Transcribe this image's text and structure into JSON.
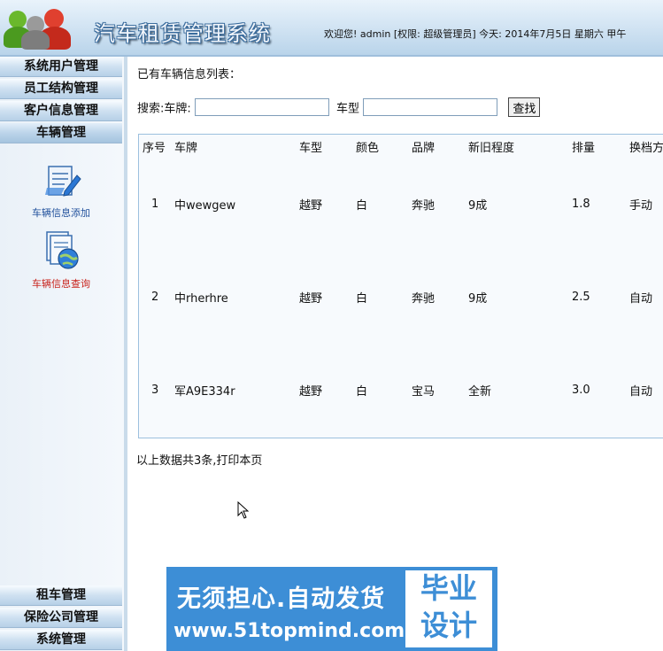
{
  "header": {
    "app_title": "汽车租赁管理系统",
    "welcome_text": "欢迎您! admin [权限: 超级管理员] 今天: 2014年7月5日 星期六 甲午"
  },
  "sidebar": {
    "top_menu": [
      {
        "label": "系统用户管理"
      },
      {
        "label": "员工结构管理"
      },
      {
        "label": "客户信息管理"
      },
      {
        "label": "车辆管理"
      }
    ],
    "sub_items": [
      {
        "label": "车辆信息添加",
        "icon": "document-edit-icon"
      },
      {
        "label": "车辆信息查询",
        "icon": "document-globe-icon"
      }
    ],
    "bottom_menu": [
      {
        "label": "租车管理"
      },
      {
        "label": "保险公司管理"
      },
      {
        "label": "系统管理"
      }
    ]
  },
  "main": {
    "list_title": "已有车辆信息列表：",
    "search": {
      "label_prefix": "搜索:车牌:",
      "plate_value": "",
      "type_label": "车型",
      "type_value": "",
      "button_label": "查找"
    },
    "table": {
      "headers": [
        "序号",
        "车牌",
        "车型",
        "颜色",
        "品牌",
        "新旧程度",
        "排量",
        "换档方"
      ],
      "rows": [
        [
          "1",
          "中wewgew",
          "越野",
          "白",
          "奔驰",
          "9成",
          "1.8",
          "手动"
        ],
        [
          "2",
          "中rherhre",
          "越野",
          "白",
          "奔驰",
          "9成",
          "2.5",
          "自动"
        ],
        [
          "3",
          "军A9E334r",
          "越野",
          "白",
          "宝马",
          "全新",
          "3.0",
          "自动"
        ]
      ]
    },
    "summary": "以上数据共3条,打印本页"
  },
  "banner": {
    "line1": "无须担心.自动发货",
    "line2": "www.51topmind.com",
    "right_top": "毕业",
    "right_bottom": "设计"
  },
  "colors": {
    "header_bg": "#cfe2f2",
    "menu_bg": "#b6d0e7",
    "table_border": "#9cc0de",
    "banner_bg": "#3d8ed6",
    "query_link": "#c8221b",
    "add_link": "#1f4f9b"
  }
}
